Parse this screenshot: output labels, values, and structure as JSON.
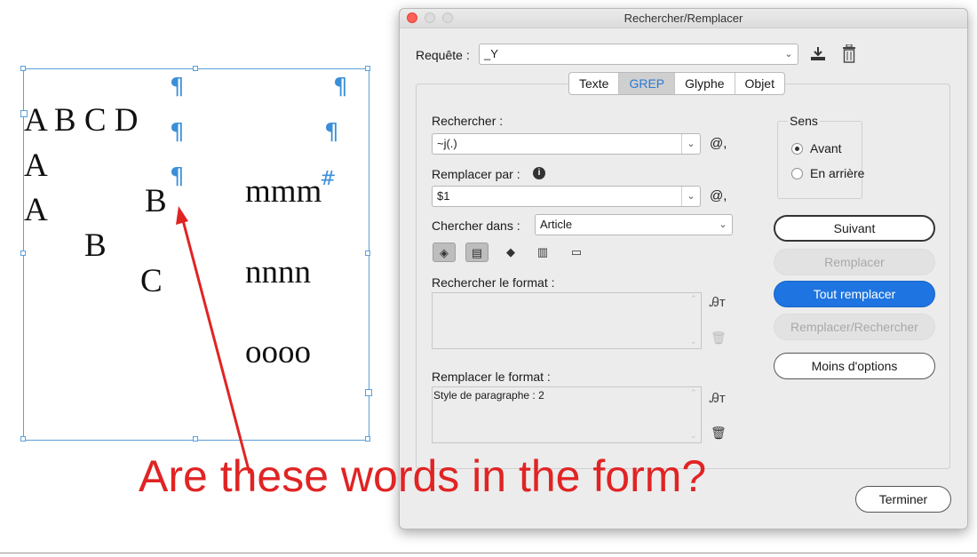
{
  "document": {
    "lines": [
      {
        "parts": [
          "A B C D",
          "mmm"
        ],
        "marks": [
          "¶",
          "¶"
        ]
      },
      {
        "parts": [
          "A",
          "B",
          "nnnn"
        ],
        "marks": [
          "¶",
          "¶"
        ]
      },
      {
        "parts": [
          "A",
          "B",
          "C",
          "oooo"
        ],
        "marks": [
          "¶",
          "#"
        ]
      }
    ]
  },
  "dialog": {
    "title": "Rechercher/Remplacer",
    "query_label": "Requête :",
    "query_value": "_Y",
    "tabs": [
      "Texte",
      "GREP",
      "Glyphe",
      "Objet"
    ],
    "active_tab": "GREP",
    "search_label": "Rechercher :",
    "search_value": "~j(.)",
    "replace_label": "Remplacer par :",
    "replace_value": "$1",
    "search_in_label": "Chercher dans :",
    "search_in_value": "Article",
    "find_format_label": "Rechercher le format :",
    "replace_format_label": "Remplacer le format :",
    "replace_format_value": "Style de paragraphe : 2",
    "direction": {
      "label": "Sens",
      "options": [
        "Avant",
        "En arrière"
      ],
      "selected": "Avant"
    },
    "buttons": {
      "next": "Suivant",
      "replace": "Remplacer",
      "replace_all": "Tout remplacer",
      "replace_find": "Remplacer/Rechercher",
      "fewer_options": "Moins d'options",
      "done": "Terminer"
    },
    "special_char_glyph": "@,",
    "accent_color": "#1e74e0"
  },
  "annotation": {
    "text": "Are these words in the form?",
    "color": "#e02424"
  }
}
